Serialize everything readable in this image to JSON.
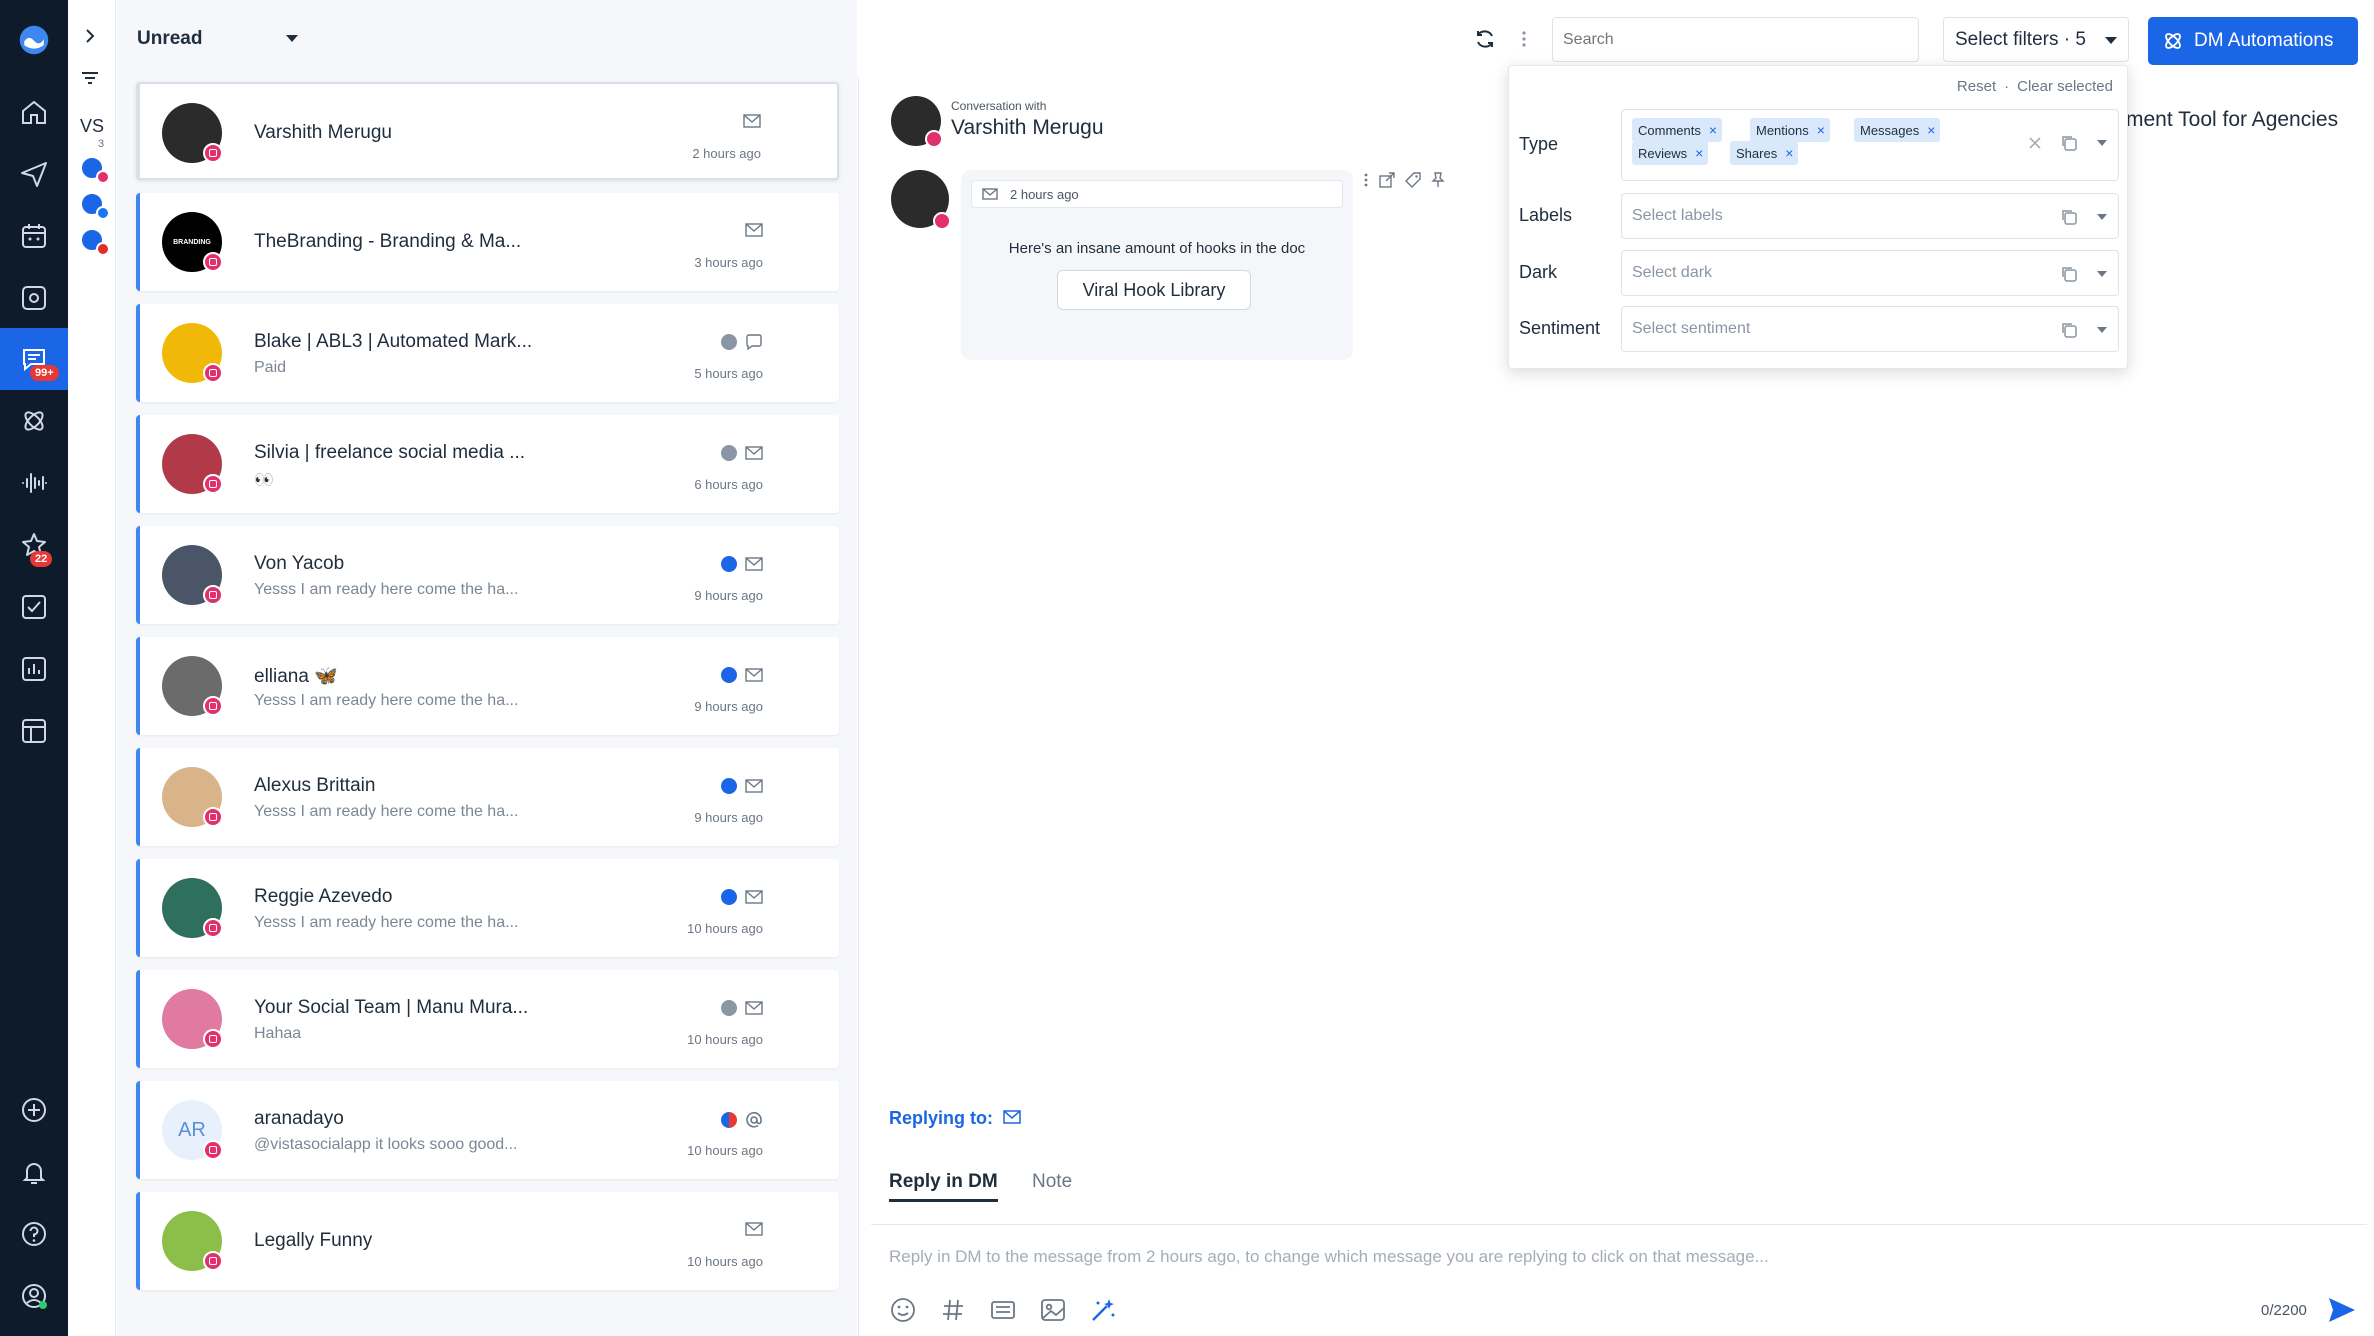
{
  "rail": {
    "inbox_badge": "99+",
    "star_badge": "22"
  },
  "profiles": {
    "initials": "VS",
    "count": "3"
  },
  "list": {
    "view_label": "Unread",
    "items": [
      {
        "name": "Varshith Merugu",
        "preview": "",
        "time": "2 hours ago",
        "icons": [
          "mail-icon"
        ],
        "avatar_color": "#2b2b2b"
      },
      {
        "name": "TheBranding - Branding & Ma...",
        "preview": "",
        "time": "3 hours ago",
        "icons": [
          "mail-icon"
        ],
        "avatar_color": "#000000",
        "avatar_text": "BRANDING"
      },
      {
        "name": "Blake | ABL3 | Automated Mark...",
        "preview": "Paid",
        "time": "5 hours ago",
        "icons": [
          "neutral-mood-icon",
          "comment-icon"
        ],
        "avatar_color": "#f2b807"
      },
      {
        "name": "Silvia | freelance social media ...",
        "preview": "👀",
        "time": "6 hours ago",
        "icons": [
          "neutral-mood-icon",
          "mail-icon"
        ],
        "avatar_color": "#b23a48"
      },
      {
        "name": "Von Yacob",
        "preview": "Yesss I am ready here come the ha...",
        "time": "9 hours ago",
        "icons": [
          "positive-mood-icon",
          "mail-icon"
        ],
        "avatar_color": "#4a5568"
      },
      {
        "name": "elliana 🦋",
        "preview": "Yesss I am ready here come the ha...",
        "time": "9 hours ago",
        "icons": [
          "positive-mood-icon",
          "mail-icon"
        ],
        "avatar_color": "#6b6b6b"
      },
      {
        "name": "Alexus Brittain",
        "preview": "Yesss I am ready here come the ha...",
        "time": "9 hours ago",
        "icons": [
          "positive-mood-icon",
          "mail-icon"
        ],
        "avatar_color": "#d9b48a"
      },
      {
        "name": "Reggie Azevedo",
        "preview": "Yesss I am ready here come the ha...",
        "time": "10 hours ago",
        "icons": [
          "positive-mood-icon",
          "mail-icon"
        ],
        "avatar_color": "#2f6f5e"
      },
      {
        "name": "Your Social Team | Manu Mura...",
        "preview": "Hahaa",
        "time": "10 hours ago",
        "icons": [
          "neutral-mood-icon",
          "mail-icon"
        ],
        "avatar_color": "#e07aa0"
      },
      {
        "name": "aranadayo",
        "preview": "@vistasocialapp it looks sooo good...",
        "time": "10 hours ago",
        "icons": [
          "mixed-mood-icon",
          "at-icon"
        ],
        "avatar_color": "#e8f1fb",
        "avatar_text": "AR"
      },
      {
        "name": "Legally Funny",
        "preview": "",
        "time": "10 hours ago",
        "icons": [
          "mail-icon"
        ],
        "avatar_color": "#8bbf4a"
      }
    ]
  },
  "topbar": {
    "search_placeholder": "Search",
    "filters_label": "Select filters · 5",
    "dm_label": "DM Automations"
  },
  "filters": {
    "reset": "Reset",
    "sep": "·",
    "clear": "Clear selected",
    "type_label": "Type",
    "type_chips": [
      "Comments",
      "Mentions",
      "Messages",
      "Reviews",
      "Shares"
    ],
    "labels_label": "Labels",
    "labels_placeholder": "Select labels",
    "dark_label": "Dark",
    "dark_placeholder": "Select dark",
    "sentiment_label": "Sentiment",
    "sentiment_placeholder": "Select sentiment"
  },
  "conversation": {
    "with_label": "Conversation with",
    "contact": "Varshith Merugu",
    "title_tail": "ment Tool for Agencies",
    "message_time": "2 hours ago",
    "message_text": "Here's an insane amount of hooks in the doc",
    "message_button": "Viral Hook Library",
    "replying_to": "Replying to:",
    "tab_dm": "Reply in DM",
    "tab_note": "Note",
    "reply_placeholder": "Reply in DM to the message from 2 hours ago, to change which message you are replying to click on that message...",
    "char_count": "0/2200"
  },
  "colors": {
    "accent": "#1a66e6",
    "rail": "#0d1b2a",
    "instagram": "#e1306c"
  }
}
